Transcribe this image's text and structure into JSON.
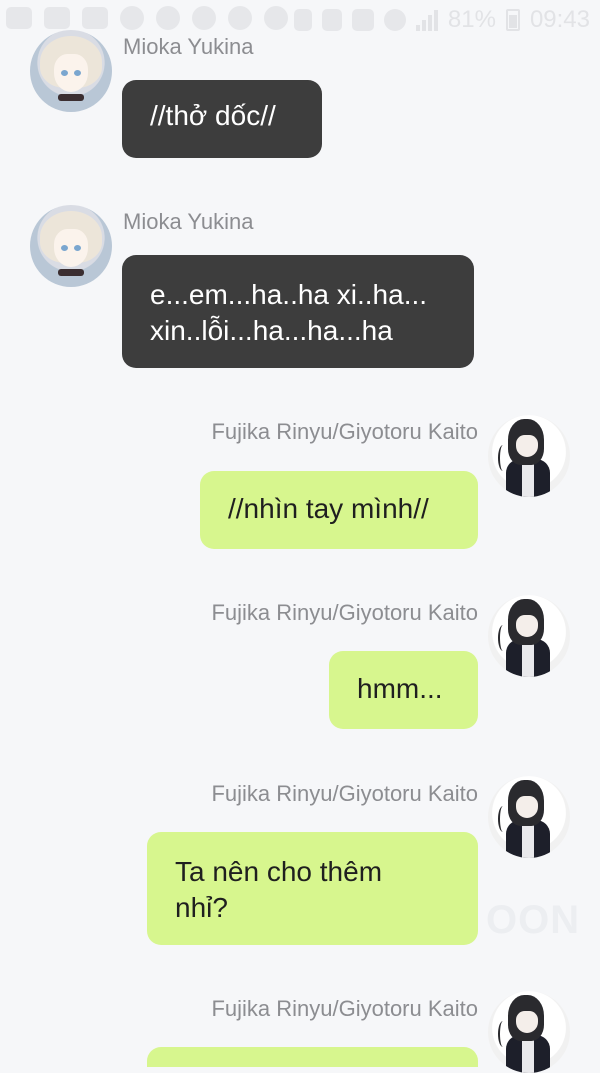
{
  "status_bar": {
    "battery_percent": "81%",
    "time": "09:43"
  },
  "messages": [
    {
      "sender": "Mioka Yukina",
      "side": "left",
      "avatar_icon": "mioka-avatar-icon",
      "lines": [
        "//thở dốc//"
      ]
    },
    {
      "sender": "Mioka Yukina",
      "side": "left",
      "avatar_icon": "mioka-avatar-icon",
      "lines": [
        "e...em...ha..ha xi..ha...",
        "xin..lỗi...ha...ha...ha"
      ]
    },
    {
      "sender": "Fujika Rinyu/Giyotoru Kaito",
      "side": "right",
      "avatar_icon": "kaito-avatar-icon",
      "lines": [
        "//nhìn tay mình//"
      ]
    },
    {
      "sender": "Fujika Rinyu/Giyotoru Kaito",
      "side": "right",
      "avatar_icon": "kaito-avatar-icon",
      "lines": [
        "hmm..."
      ]
    },
    {
      "sender": "Fujika Rinyu/Giyotoru Kaito",
      "side": "right",
      "avatar_icon": "kaito-avatar-icon",
      "lines": [
        "Ta nên cho thêm",
        "nhỉ?"
      ]
    },
    {
      "sender": "Fujika Rinyu/Giyotoru Kaito",
      "side": "right",
      "avatar_icon": "kaito-avatar-icon",
      "lines": []
    }
  ],
  "colors": {
    "background": "#f6f7f9",
    "left_bubble": "#3d3d3d",
    "right_bubble": "#d7f68e",
    "sender_name": "#8c8d91"
  }
}
